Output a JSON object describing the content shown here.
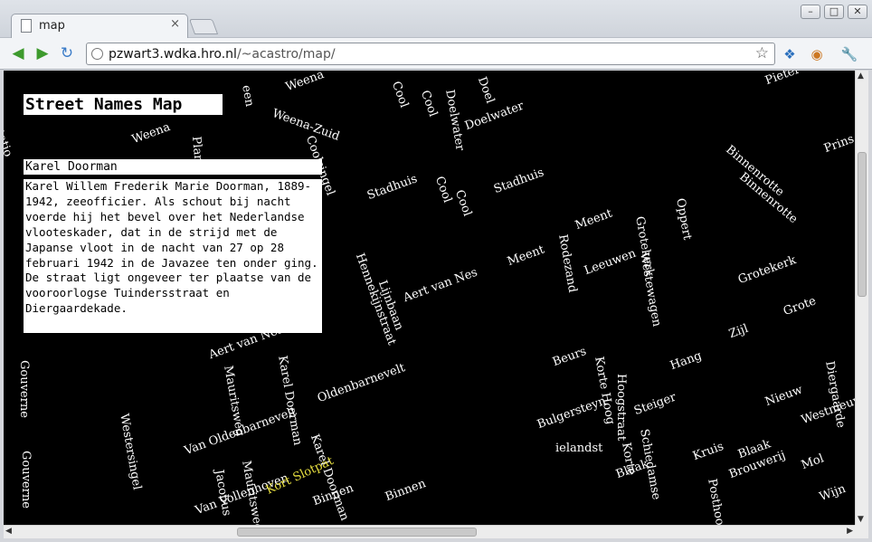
{
  "browser": {
    "tab_title": "map",
    "tab_close": "×",
    "url_host": "pzwart3.wdka.hro.nl",
    "url_path": "/~acastro/map/",
    "window_min": "–",
    "window_max": "□",
    "window_close": "✕"
  },
  "page": {
    "title": "Street Names Map",
    "selected_street": "Karel Doorman",
    "description": "Karel Willem Frederik Marie Doorman, 1889-1942, zeeofficier. Als schout bij nacht voerde hij het bevel over het Nederlandse vlooteskader, dat in de strijd met de Japanse vloot in de nacht van 27 op 28 februari 1942 in de Javazee ten onder ging. De straat ligt ongeveer ter plaatse van de vooroorlogse Tuindersstraat en Diergaardekade.",
    "highlighted_street": "Kort Slotpat",
    "street_labels": [
      "Weena",
      "Weena-Zuid",
      "een",
      "Weena",
      "tatio",
      "Plan",
      "Cool",
      "Cool",
      "Doelwater",
      "Doel",
      "Doelwater",
      "Coolsingel",
      "Stadhuis",
      "Cool",
      "Cool",
      "Stadhuis",
      "Hennekijnstraat",
      "Lijnbaan",
      "Aert van Nes",
      "Aert van Nes",
      "Van Oldenbarnevelt",
      "Oldenbarnevelt",
      "Karel Doorman",
      "Karel Doorman",
      "Korte Hoog",
      "Hoogstraat",
      "Meent",
      "Meent",
      "Rodezand",
      "Leeuwen",
      "Westewagen",
      "Grotekerk",
      "Oppert",
      "Grotekerk",
      "Binnenrotte",
      "Binnenrotte",
      "Bulgersteyn",
      "Beurs",
      "Steiger",
      "Hang",
      "Nieuw",
      "Zijl",
      "Blaak",
      "Blaak",
      "Mol",
      "Wijn",
      "Wijn",
      "Jacobus",
      "Mauritsweg",
      "Mauritsweg",
      "Westersingel",
      "Gouverne",
      "Gouverne",
      "Van Vollenhoven",
      "ielandst",
      "Binnen",
      "Binnen",
      "Posthoorn",
      "Brouwerij",
      "Grote",
      "Westnieuw",
      "Prins",
      "Pieter",
      "Korte",
      "Kruis",
      "Schiedamse",
      "Diergaarde"
    ]
  }
}
